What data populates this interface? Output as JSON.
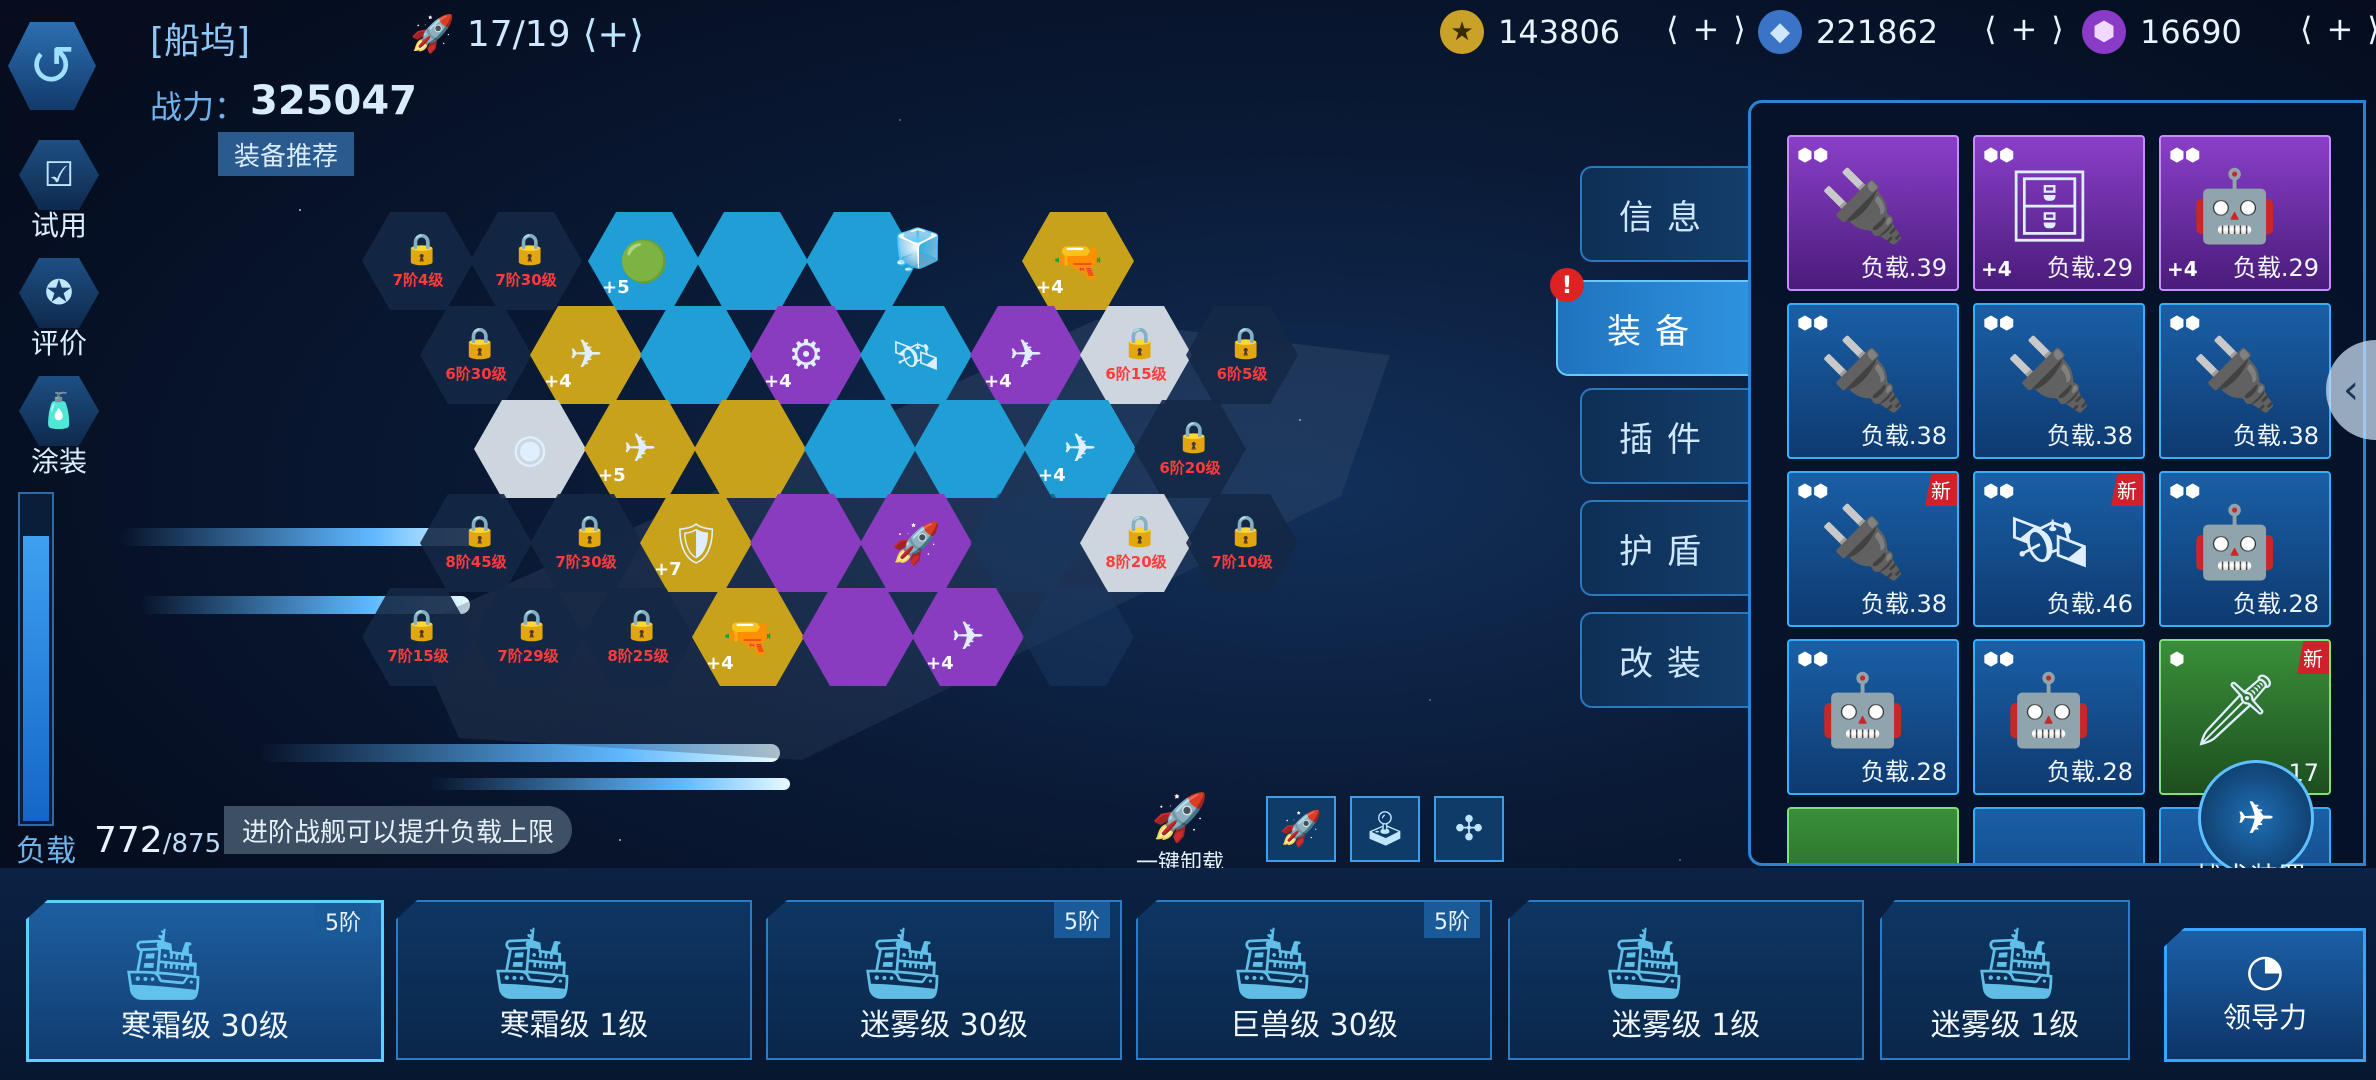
{
  "header": {
    "title": "[船坞]",
    "ship_count": "17/19",
    "resources": [
      {
        "name": "gold-coin-icon",
        "value": "143806"
      },
      {
        "name": "ore-icon",
        "value": "221862"
      },
      {
        "name": "crystal-icon",
        "value": "16690"
      }
    ],
    "plus": "+"
  },
  "power": {
    "label": "战力：",
    "value": "325047"
  },
  "recommend_button": "装备推荐",
  "side_buttons": [
    {
      "label": "试用",
      "icon": "check-icon"
    },
    {
      "label": "评价",
      "icon": "badge-icon"
    },
    {
      "label": "涂装",
      "icon": "spray-icon"
    }
  ],
  "load": {
    "label": "负载",
    "value": "772",
    "max": "/875",
    "fraction": 0.882
  },
  "tip": "进阶战舰可以提升负载上限",
  "hex_locks": [
    "7阶4级",
    "7阶30级",
    "6阶30级",
    "6阶15级",
    "6阶5级",
    "6阶20级",
    "8阶45级",
    "7阶30级",
    "8阶20级",
    "7阶10级",
    "7阶15级",
    "7阶29级",
    "8阶25级"
  ],
  "hex_plus": [
    "+5",
    "+4",
    "+4",
    "+4",
    "+4",
    "+5",
    "+4",
    "+7",
    "+4",
    "+4"
  ],
  "tabs": [
    "信息",
    "装备",
    "插件",
    "护盾",
    "改装"
  ],
  "equipment": [
    {
      "load": "负载.39",
      "plus": "",
      "new": ""
    },
    {
      "load": "负载.29",
      "plus": "+4",
      "new": ""
    },
    {
      "load": "负载.29",
      "plus": "+4",
      "new": ""
    },
    {
      "load": "负载.38",
      "plus": "",
      "new": ""
    },
    {
      "load": "负载.38",
      "plus": "",
      "new": ""
    },
    {
      "load": "负载.38",
      "plus": "",
      "new": ""
    },
    {
      "load": "负载.38",
      "plus": "",
      "new": "新"
    },
    {
      "load": "负载.46",
      "plus": "",
      "new": "新"
    },
    {
      "load": "负载.28",
      "plus": "",
      "new": ""
    },
    {
      "load": "负载.28",
      "plus": "",
      "new": ""
    },
    {
      "load": "负载.28",
      "plus": "",
      "new": ""
    },
    {
      "load": ".17",
      "plus": "",
      "new": "新"
    }
  ],
  "unload_button": "一键卸载",
  "tactic": "战术装置",
  "ships": [
    {
      "name": "寒霜级 30级",
      "tier": "5阶"
    },
    {
      "name": "寒霜级 1级",
      "tier": ""
    },
    {
      "name": "迷雾级 30级",
      "tier": "5阶"
    },
    {
      "name": "巨兽级 30级",
      "tier": "5阶"
    },
    {
      "name": "迷雾级 1级",
      "tier": ""
    },
    {
      "name": "迷雾级 1级",
      "tier": ""
    }
  ],
  "leader_button": "领导力"
}
